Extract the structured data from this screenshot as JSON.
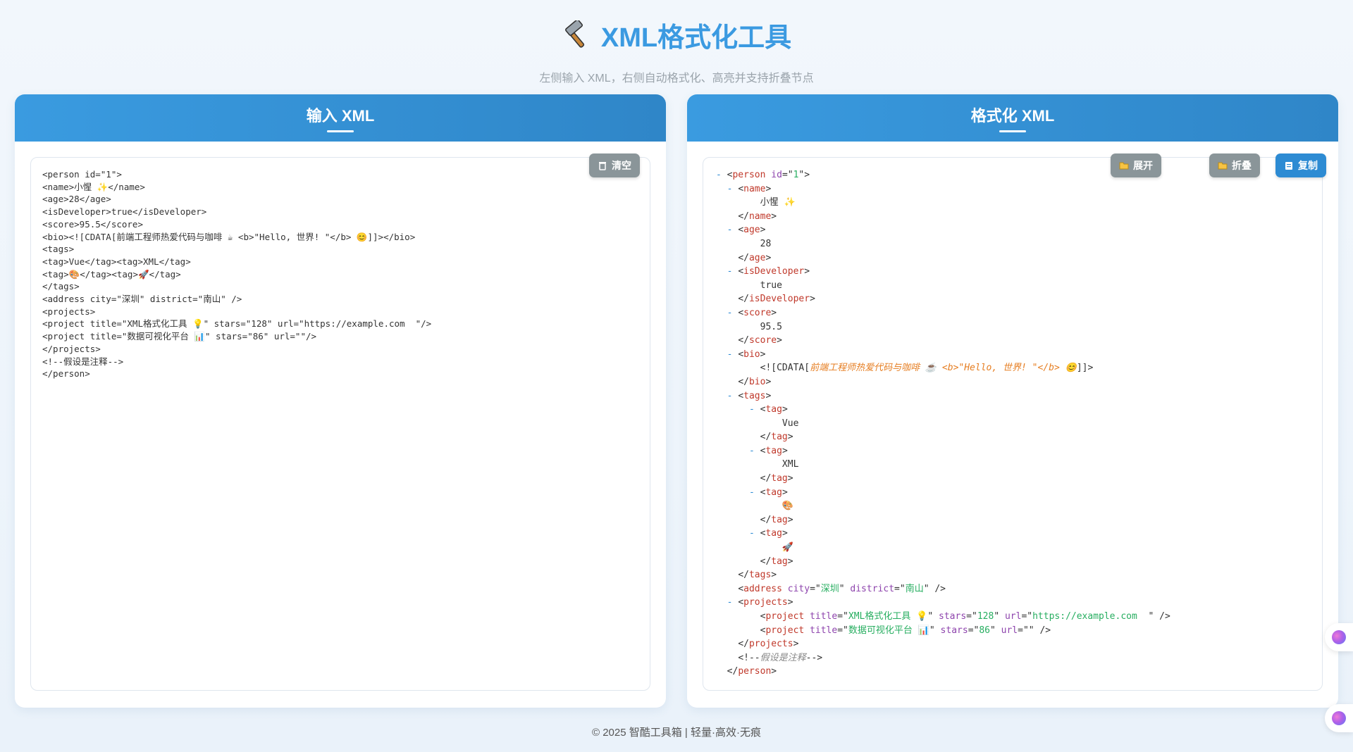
{
  "header": {
    "title": "XML格式化工具",
    "subtitle": "左侧输入 XML，右侧自动格式化、高亮并支持折叠节点"
  },
  "input_panel": {
    "title": "输入 XML",
    "clear_button": "清空",
    "content": "<person id=\"1\">\n<name>小惺 ✨</name>\n<age>28</age>\n<isDeveloper>true</isDeveloper>\n<score>95.5</score>\n<bio><![CDATA[前端工程师热爱代码与咖啡 ☕ <b>\"Hello, 世界! \"</b> 😊]]></bio>\n<tags>\n<tag>Vue</tag><tag>XML</tag>\n<tag>🎨</tag><tag>🚀</tag>\n</tags>\n<address city=\"深圳\" district=\"南山\" />\n<projects>\n<project title=\"XML格式化工具 💡\" stars=\"128\" url=\"https://example.com  \"/>\n<project title=\"数据可视化平台 📊\" stars=\"86\" url=\"\"/>\n</projects>\n<!--假设是注释-->\n</person>"
  },
  "output_panel": {
    "title": "格式化 XML",
    "expand_button": "展开",
    "collapse_button": "折叠",
    "copy_button": "复制",
    "tree": {
      "person_tag": "person",
      "person_attr": "id",
      "person_val": "1",
      "name_tag": "name",
      "name_text": "小惺 ✨",
      "age_tag": "age",
      "age_text": "28",
      "isdev_tag": "isDeveloper",
      "isdev_text": "true",
      "score_tag": "score",
      "score_text": "95.5",
      "bio_tag": "bio",
      "cdata_open": "<![CDATA[",
      "cdata_text": "前端工程师热爱代码与咖啡 ☕ <b>\"Hello, 世界! \"</b> 😊",
      "cdata_close": "]]>",
      "tags_tag": "tags",
      "tag_tag": "tag",
      "tag1_text": "Vue",
      "tag2_text": "XML",
      "tag3_text": "🎨",
      "tag4_text": "🚀",
      "address_tag": "address",
      "address_attr1": "city",
      "address_val1": "深圳",
      "address_attr2": "district",
      "address_val2": "南山",
      "projects_tag": "projects",
      "project_tag": "project",
      "title_attr": "title",
      "stars_attr": "stars",
      "url_attr": "url",
      "p1_title": "XML格式化工具 💡",
      "p1_stars": "128",
      "p1_url": "https://example.com  ",
      "p2_title": "数据可视化平台 📊",
      "p2_stars": "86",
      "p2_url": "",
      "comment_open": "<!--",
      "comment_text": "假设是注释",
      "comment_close": "-->"
    }
  },
  "footer": "© 2025 智酷工具箱 | 轻量·高效·无痕",
  "colors": {
    "accent": "#3b9ae1",
    "tag": "#c0392b",
    "attr": "#8e44ad",
    "value": "#27ae60",
    "cdata": "#e67e22"
  }
}
